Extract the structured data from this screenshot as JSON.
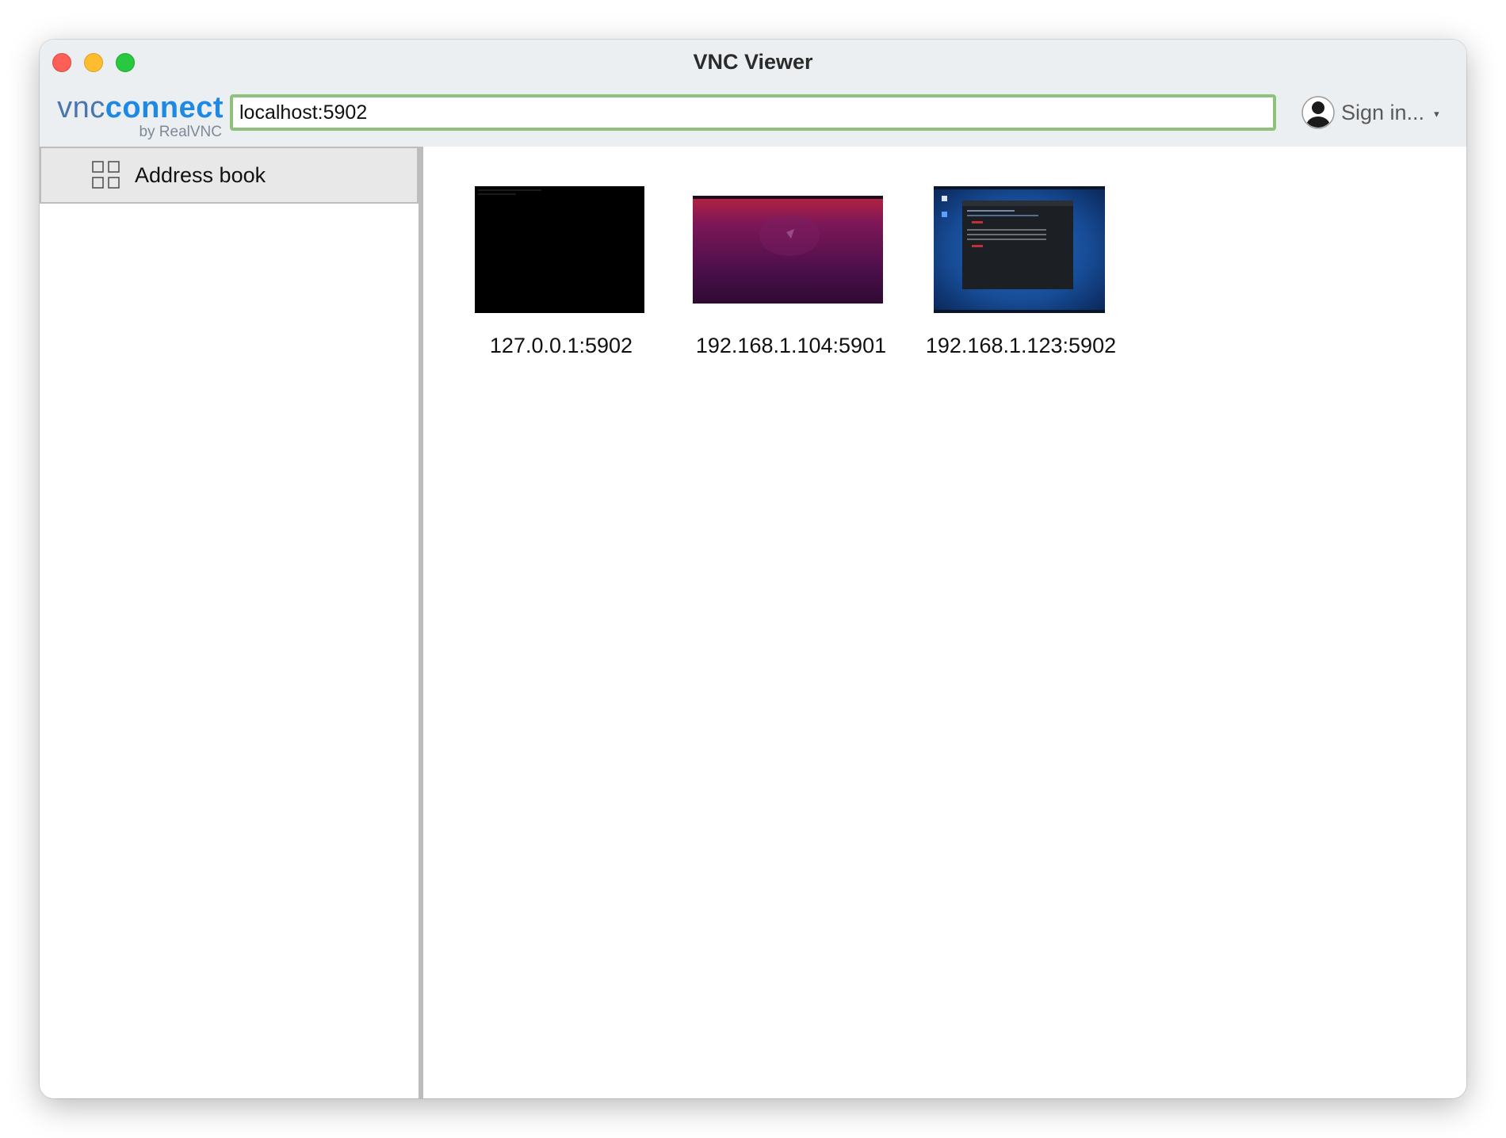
{
  "window": {
    "title": "VNC Viewer"
  },
  "logo": {
    "vnc": "vnc",
    "connect": "connect",
    "byline": "by RealVNC"
  },
  "toolbar": {
    "address_value": "localhost:5902",
    "address_border_color": "#8ec27a",
    "signin_label": "Sign in...",
    "signin_caret": "▾"
  },
  "sidebar": {
    "items": [
      {
        "label": "Address book",
        "icon": "grid-icon"
      }
    ]
  },
  "connections": [
    {
      "label": "127.0.0.1:5902",
      "thumbnail": "black-terminal"
    },
    {
      "label": "192.168.1.104:5901",
      "thumbnail": "ubuntu-purple-desktop"
    },
    {
      "label": "192.168.1.123:5902",
      "thumbnail": "blue-desktop-terminal"
    }
  ],
  "colors": {
    "traffic_close": "#fe5f57",
    "traffic_minimize": "#febc2e",
    "traffic_zoom": "#28c840",
    "brand_blue": "#1e88e5"
  }
}
